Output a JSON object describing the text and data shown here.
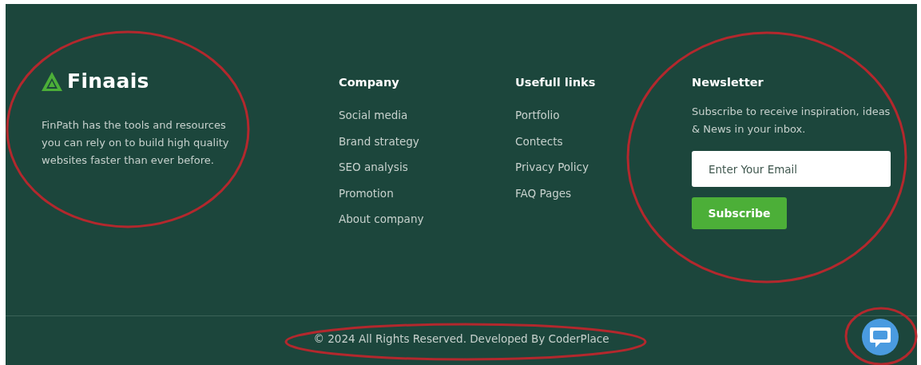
{
  "brand": {
    "name": "Finaais",
    "description": "FinPath has the tools and resources you can rely on to build high quality websites faster than ever before."
  },
  "columns": [
    {
      "title": "Company",
      "links": [
        "Social media",
        "Brand strategy",
        "SEO analysis",
        "Promotion",
        "About company"
      ]
    },
    {
      "title": "Usefull links",
      "links": [
        "Portfolio",
        "Contects",
        "Privacy Policy",
        "FAQ Pages"
      ]
    }
  ],
  "newsletter": {
    "title": "Newsletter",
    "text": "Subscribe to receive inspiration, ideas & News in your inbox.",
    "placeholder": "Enter Your Email",
    "button": "Subscribe"
  },
  "copyright": "© 2024 All Rights Reserved. Developed By CoderPlace"
}
